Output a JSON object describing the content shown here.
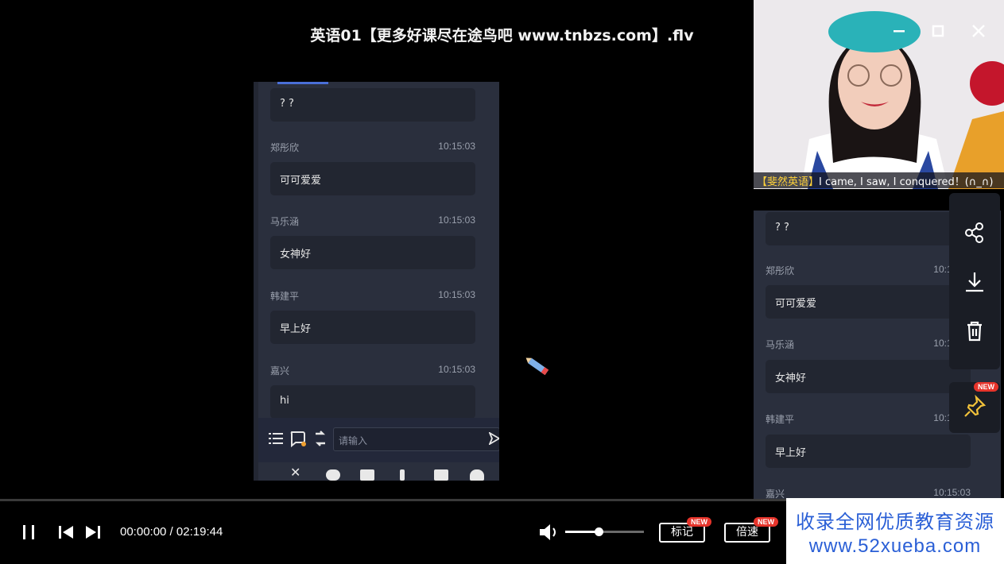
{
  "window": {
    "title": "英语01【更多好课尽在途鸟吧 www.tnbzs.com】.flv"
  },
  "video_caption": {
    "tag": "【斐然英语】",
    "text": "I came, I saw, I conquered！(∩_∩)"
  },
  "chat_main": {
    "first_bubble": "? ?",
    "messages": [
      {
        "name": "郑彤欣",
        "time": "10:15:03",
        "text": "可可爱爱"
      },
      {
        "name": "马乐涵",
        "time": "10:15:03",
        "text": "女神好"
      },
      {
        "name": "韩建平",
        "time": "10:15:03",
        "text": "早上好"
      },
      {
        "name": "嘉兴",
        "time": "10:15:03",
        "text": "hi"
      }
    ],
    "input_placeholder": "请输入"
  },
  "chat_side": {
    "first_bubble": "? ?",
    "messages": [
      {
        "name": "郑彤欣",
        "time": "10:15:03",
        "text": "可可爱爱"
      },
      {
        "name": "马乐涵",
        "time": "10:15:03",
        "text": "女神好"
      },
      {
        "name": "韩建平",
        "time": "10:15:03",
        "text": "早上好"
      },
      {
        "name": "嘉兴",
        "time": "10:15:03",
        "text": ""
      }
    ]
  },
  "toolbar": {
    "icons": [
      "share-icon",
      "download-icon",
      "trash-icon",
      "pin-icon"
    ],
    "pin_badge": "NEW"
  },
  "player": {
    "current_time": "00:00:00",
    "separator": " / ",
    "duration": "02:19:44",
    "progress_fraction": 0.0,
    "volume_fraction": 0.42,
    "mark_label": "标记",
    "mark_badge": "NEW",
    "speed_label": "倍速",
    "speed_badge": "NEW"
  },
  "watermark": {
    "line1": "收录全网优质教育资源",
    "line2": "www.52xueba.com"
  },
  "colors": {
    "accent": "#4a7bff",
    "badge": "#e6342b",
    "panel": "#2a2f3d",
    "bubble": "#222631",
    "caption_tag": "#ffd23a",
    "watermark_text": "#2a5fd6"
  }
}
